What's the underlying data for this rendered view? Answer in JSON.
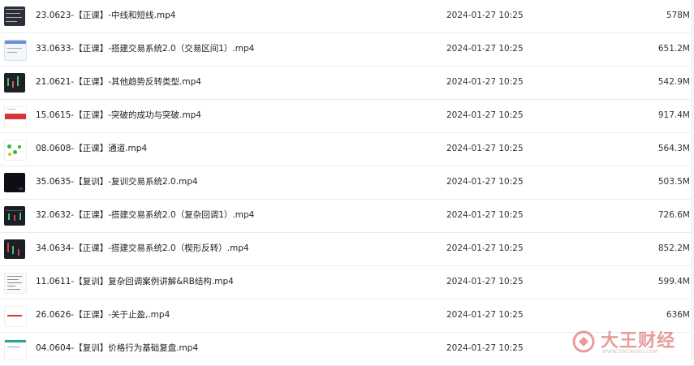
{
  "files": [
    {
      "name": "23.0623-【正课】-中线和短线.mp4",
      "modified": "2024-01-27 10:25",
      "size": "578M",
      "thumb": "dark-grid"
    },
    {
      "name": "33.0633-【正课】-搭建交易系统2.0（交易区间1）.mp4",
      "modified": "2024-01-27 10:25",
      "size": "651.2M",
      "thumb": "light-blue"
    },
    {
      "name": "21.0621-【正课】-其他趋势反转类型.mp4",
      "modified": "2024-01-27 10:25",
      "size": "542.9M",
      "thumb": "dark"
    },
    {
      "name": "15.0615-【正课】-突破的成功与突破.mp4",
      "modified": "2024-01-27 10:25",
      "size": "917.4M",
      "thumb": "red-band"
    },
    {
      "name": "08.0608-【正课】通道.mp4",
      "modified": "2024-01-27 10:25",
      "size": "564.3M",
      "thumb": "green-dots"
    },
    {
      "name": "35.0635-【复训】-复训交易系统2.0.mp4",
      "modified": "2024-01-27 10:25",
      "size": "503.5M",
      "thumb": "black"
    },
    {
      "name": "32.0632-【正课】-搭建交易系统2.0（复杂回调1）.mp4",
      "modified": "2024-01-27 10:25",
      "size": "726.6M",
      "thumb": "dark"
    },
    {
      "name": "34.0634-【正课】-搭建交易系统2.0（楔形反转）.mp4",
      "modified": "2024-01-27 10:25",
      "size": "852.2M",
      "thumb": "dark"
    },
    {
      "name": "11.0611-【复训】复杂回调案例讲解&RB结构.mp4",
      "modified": "2024-01-27 10:25",
      "size": "599.4M",
      "thumb": "light-text"
    },
    {
      "name": "26.0626-【正课】-关于止盈,.mp4",
      "modified": "2024-01-27 10:25",
      "size": "636M",
      "thumb": "red-line"
    },
    {
      "name": "04.0604-【复训】价格行为基础复盘.mp4",
      "modified": "2024-01-27 10:25",
      "size": "",
      "thumb": "teal"
    }
  ],
  "watermark": {
    "text": "大王财经",
    "sub": "WWW.DWCAIJING.COM"
  }
}
